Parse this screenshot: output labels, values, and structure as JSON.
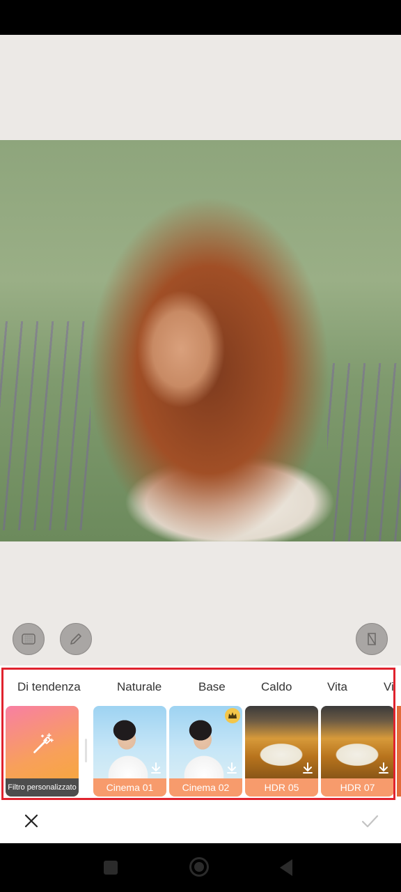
{
  "editor": {
    "photo_alt": "Portrait photo of woman with curly auburn hair in lavender field"
  },
  "tools": {
    "left": [
      {
        "name": "mask-tool",
        "icon": "grid-square-icon"
      },
      {
        "name": "brush-tool",
        "icon": "pencil-icon"
      }
    ],
    "right": {
      "name": "compare-tool",
      "icon": "compare-icon"
    }
  },
  "filter_tabs": [
    "Di tendenza",
    "Naturale",
    "Base",
    "Caldo",
    "Vita",
    "Vi"
  ],
  "custom_filter": {
    "label": "Filtro personalizzato",
    "icon": "magic-wand-icon"
  },
  "filters": [
    {
      "label": "Cinema 01",
      "style": "portrait",
      "download": true,
      "premium": false
    },
    {
      "label": "Cinema 02",
      "style": "portrait",
      "download": true,
      "premium": true
    },
    {
      "label": "HDR 05",
      "style": "road",
      "download": true,
      "premium": false
    },
    {
      "label": "HDR 07",
      "style": "road",
      "download": true,
      "premium": false
    }
  ],
  "actions": {
    "cancel_icon": "close-icon",
    "apply_icon": "check-icon"
  },
  "colors": {
    "accent": "#f79b6c",
    "highlight_border": "#e0232e",
    "premium_crown": "#f3c64a"
  }
}
